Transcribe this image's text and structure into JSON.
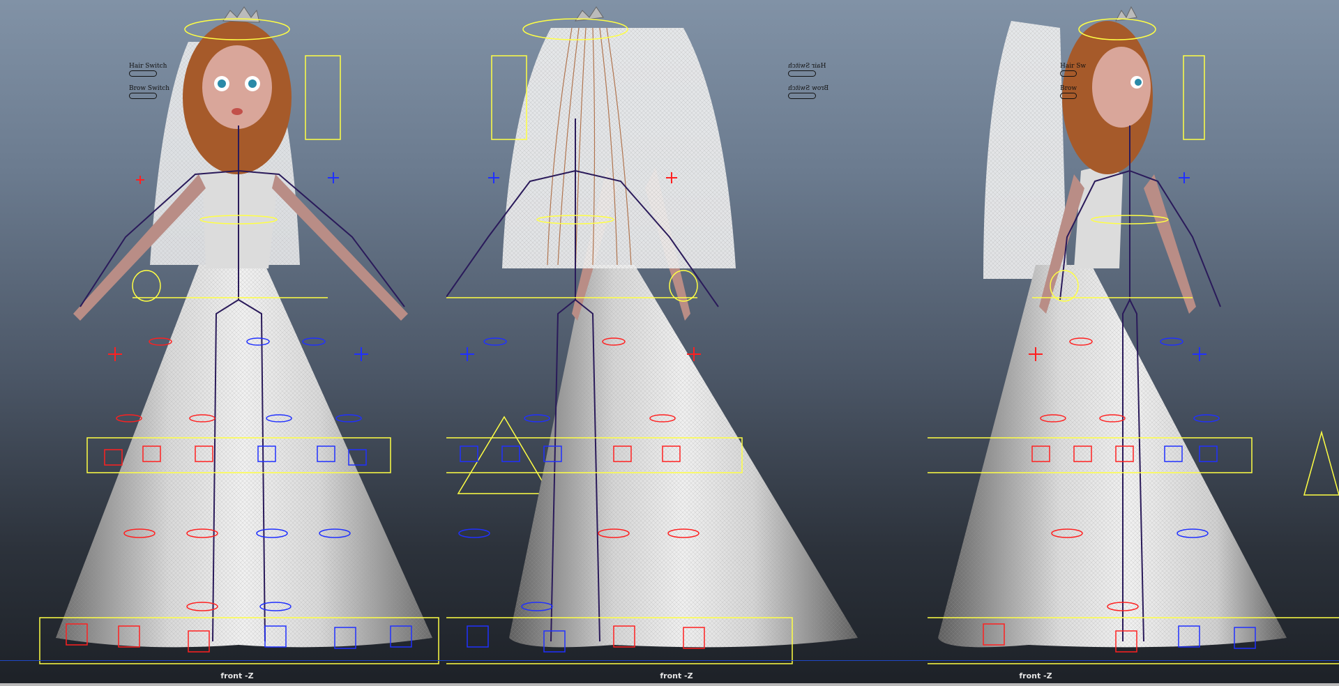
{
  "app": "Maya viewport - bridal character rig",
  "viewports": [
    {
      "id": "front",
      "camera_label": "front -Z",
      "switches": [
        {
          "label": "Hair Switch"
        },
        {
          "label": "Brow Switch"
        }
      ]
    },
    {
      "id": "back",
      "camera_label": "front -Z",
      "switches": [
        {
          "label": "Hair Switch"
        },
        {
          "label": "Brow Switch"
        }
      ]
    },
    {
      "id": "side",
      "camera_label": "front -Z",
      "switches": [
        {
          "label": "Hair Sw"
        },
        {
          "label": "Brow"
        }
      ]
    }
  ],
  "colors": {
    "control_yellow": "#ffff44",
    "control_red": "#ff2020",
    "control_blue": "#2030ff",
    "skeleton": "#2a1a5a",
    "dress": "#d9d9d9",
    "hair": "#a65a2a",
    "skin": "#c99a90"
  }
}
